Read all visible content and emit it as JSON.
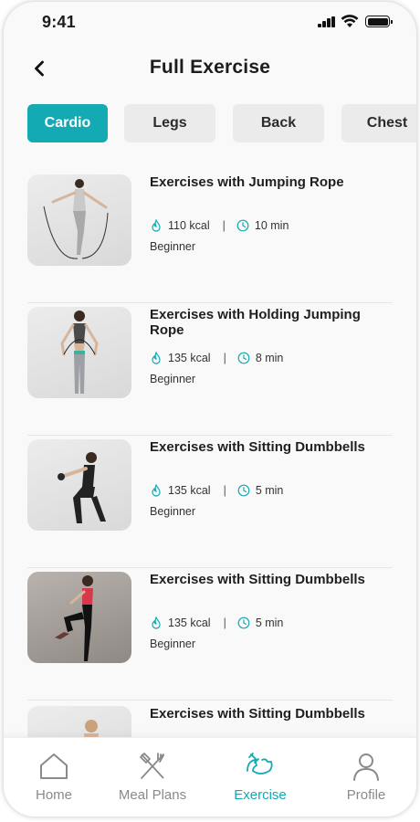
{
  "status_bar": {
    "time": "9:41"
  },
  "header": {
    "title": "Full Exercise"
  },
  "tabs": [
    {
      "label": "Cardio",
      "active": true
    },
    {
      "label": "Legs",
      "active": false
    },
    {
      "label": "Back",
      "active": false
    },
    {
      "label": "Chest",
      "active": false
    }
  ],
  "exercises": [
    {
      "title": "Exercises with Jumping Rope",
      "kcal": "110 kcal",
      "duration": "10 min",
      "level": "Beginner"
    },
    {
      "title": "Exercises with Holding Jumping Rope",
      "kcal": "135 kcal",
      "duration": "8 min",
      "level": "Beginner"
    },
    {
      "title": "Exercises with Sitting Dumbbells",
      "kcal": "135 kcal",
      "duration": "5 min",
      "level": "Beginner"
    },
    {
      "title": "Exercises with Sitting Dumbbells",
      "kcal": "135 kcal",
      "duration": "5 min",
      "level": "Beginner"
    },
    {
      "title": "Exercises with Sitting Dumbbells",
      "kcal": "",
      "duration": "",
      "level": ""
    }
  ],
  "meta_separator": "|",
  "bottom_nav": [
    {
      "label": "Home",
      "icon": "home-icon",
      "active": false
    },
    {
      "label": "Meal Plans",
      "icon": "fork-knife-icon",
      "active": false
    },
    {
      "label": "Exercise",
      "icon": "dumbbell-arm-icon",
      "active": true
    },
    {
      "label": "Profile",
      "icon": "user-icon",
      "active": false
    }
  ],
  "colors": {
    "accent": "#13aab3",
    "tab_inactive": "#ebebeb",
    "text": "#1f1f1f",
    "muted": "#8a8a8a"
  }
}
